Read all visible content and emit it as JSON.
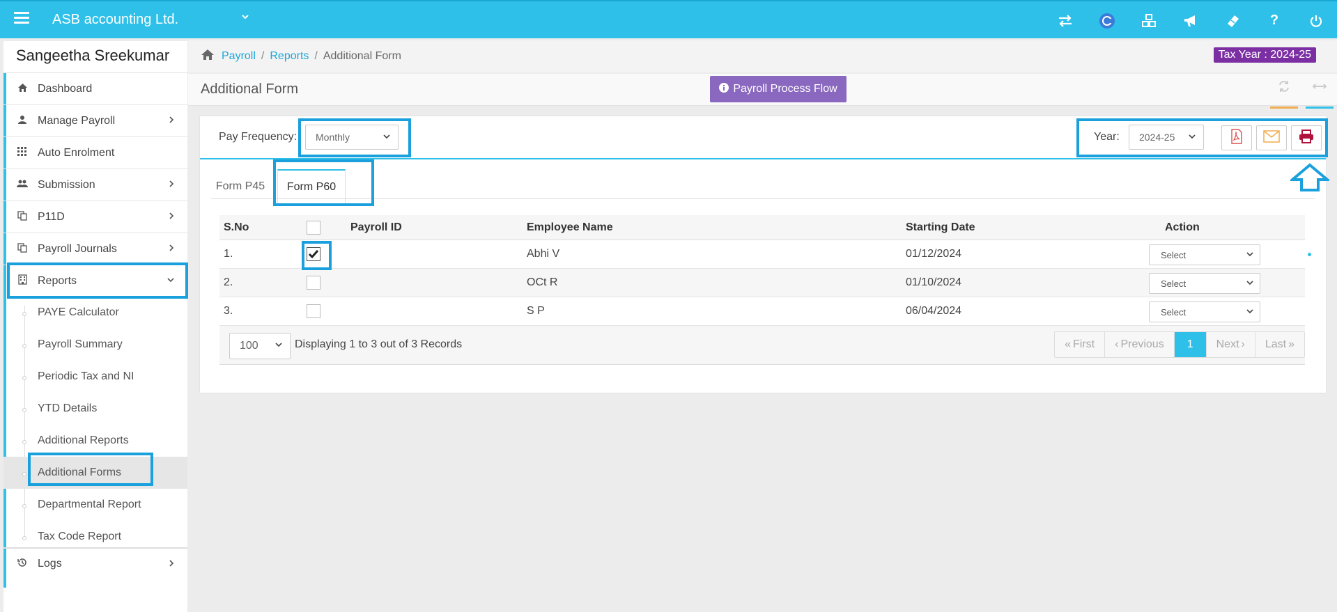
{
  "header": {
    "company": "ASB accounting Ltd.",
    "icons": [
      "switch-icon",
      "c-logo-icon",
      "cubes-icon",
      "bullhorn-icon",
      "ticket-icon",
      "help-icon",
      "power-icon"
    ],
    "help_label": "?"
  },
  "sidebar": {
    "user_name": "Sangeetha Sreekumar",
    "items": [
      {
        "label": "Dashboard",
        "icon": "home-icon"
      },
      {
        "label": "Manage Payroll",
        "icon": "user-icon"
      },
      {
        "label": "Auto Enrolment",
        "icon": "grid-icon"
      },
      {
        "label": "Submission",
        "icon": "users-icon"
      },
      {
        "label": "P11D",
        "icon": "copy-icon"
      },
      {
        "label": "Payroll Journals",
        "icon": "copy-icon"
      },
      {
        "label": "Reports",
        "icon": "building-icon"
      },
      {
        "label": "Logs",
        "icon": "history-icon"
      }
    ],
    "sub_items": [
      {
        "label": "PAYE Calculator"
      },
      {
        "label": "Payroll Summary"
      },
      {
        "label": "Periodic Tax and NI"
      },
      {
        "label": "YTD Details"
      },
      {
        "label": "Additional Reports"
      },
      {
        "label": "Additional Forms"
      },
      {
        "label": "Departmental Report"
      },
      {
        "label": "Tax Code Report"
      }
    ]
  },
  "breadcrumb": {
    "items": [
      "Payroll",
      "Reports",
      "Additional Form"
    ],
    "separator": "/",
    "tax_year": "Tax Year : 2024-25"
  },
  "page": {
    "title": "Additional Form",
    "process_flow_label": "Payroll Process Flow"
  },
  "filters": {
    "pay_frequency_label": "Pay Frequency:",
    "pay_frequency_value": "Monthly",
    "year_label": "Year:",
    "year_value": "2024-25"
  },
  "tabs": [
    {
      "label": "Form P45",
      "active": false
    },
    {
      "label": "Form P60",
      "active": true
    }
  ],
  "table": {
    "headers": [
      "S.No",
      "Payroll ID",
      "Employee Name",
      "Starting Date",
      "Action"
    ],
    "rows": [
      {
        "sno": "1.",
        "checked": true,
        "payroll_id": "",
        "name": "Abhi V",
        "start": "01/12/2024",
        "action": "Select"
      },
      {
        "sno": "2.",
        "checked": false,
        "payroll_id": "",
        "name": "OCt R",
        "start": "01/10/2024",
        "action": "Select"
      },
      {
        "sno": "3.",
        "checked": false,
        "payroll_id": "",
        "name": "S P",
        "start": "06/04/2024",
        "action": "Select"
      }
    ]
  },
  "footer": {
    "page_size": "100",
    "display_text": "Displaying 1 to 3 out of 3 Records",
    "pager": {
      "first": "First",
      "previous": "Previous",
      "current": "1",
      "next": "Next",
      "last": "Last"
    }
  },
  "colors": {
    "primary": "#2ec0e8",
    "highlight": "#1aa0dd",
    "tax_badge": "#7b2fa3",
    "flow_button": "#8a68bf",
    "pdf": "#d9534f",
    "email": "#f0ad4e",
    "print": "#b0123c"
  }
}
